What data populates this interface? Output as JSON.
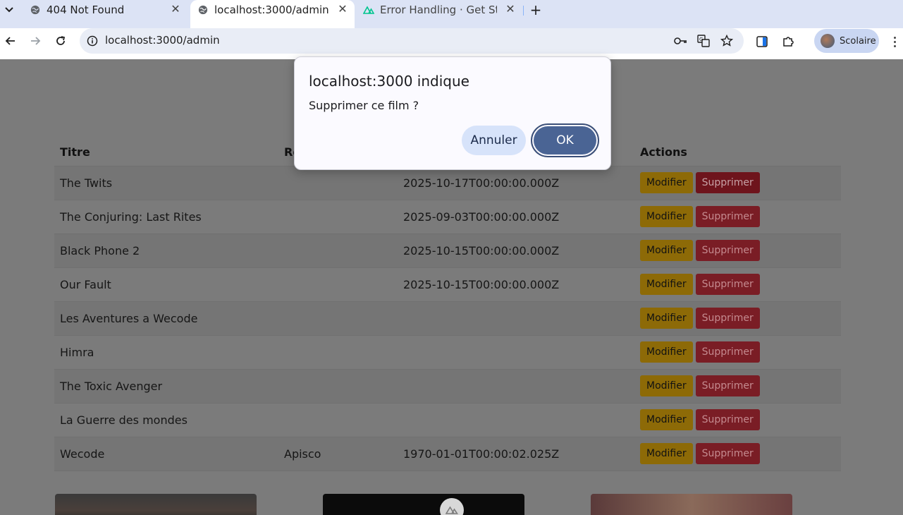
{
  "browser": {
    "tabs": [
      {
        "title": "404 Not Found",
        "favicon": "globe-icon",
        "active": false
      },
      {
        "title": "localhost:3000/admin",
        "favicon": "globe-icon",
        "active": true
      },
      {
        "title": "Error Handling · Get Sta",
        "favicon": "nuxt-icon",
        "active": false
      }
    ],
    "url": "localhost:3000/admin",
    "profile_name": "Scolaire"
  },
  "table": {
    "headers": {
      "titre": "Titre",
      "realisateur": "Ré",
      "actions": "Actions"
    },
    "rows": [
      {
        "titre": "The Twits",
        "realisateur": "",
        "date": "2025-10-17T00:00:00.000Z"
      },
      {
        "titre": "The Conjuring: Last Rites",
        "realisateur": "",
        "date": "2025-09-03T00:00:00.000Z"
      },
      {
        "titre": "Black Phone 2",
        "realisateur": "",
        "date": "2025-10-15T00:00:00.000Z"
      },
      {
        "titre": "Our Fault",
        "realisateur": "",
        "date": "2025-10-15T00:00:00.000Z"
      },
      {
        "titre": "Les Aventures a Wecode",
        "realisateur": "",
        "date": ""
      },
      {
        "titre": "Himra",
        "realisateur": "",
        "date": ""
      },
      {
        "titre": "The Toxic Avenger",
        "realisateur": "",
        "date": ""
      },
      {
        "titre": "La Guerre des mondes",
        "realisateur": "",
        "date": ""
      },
      {
        "titre": "Wecode",
        "realisateur": "Apisco",
        "date": "1970-01-01T00:00:02.025Z"
      }
    ],
    "modify_label": "Modifier",
    "delete_label": "Supprimer"
  },
  "dialog": {
    "title": "localhost:3000 indique",
    "message": "Supprimer ce film ?",
    "cancel_label": "Annuler",
    "ok_label": "OK"
  },
  "colors": {
    "accent": "#4a6494",
    "modify_button": "#8d6a07",
    "delete_button": "#7a1d25"
  }
}
